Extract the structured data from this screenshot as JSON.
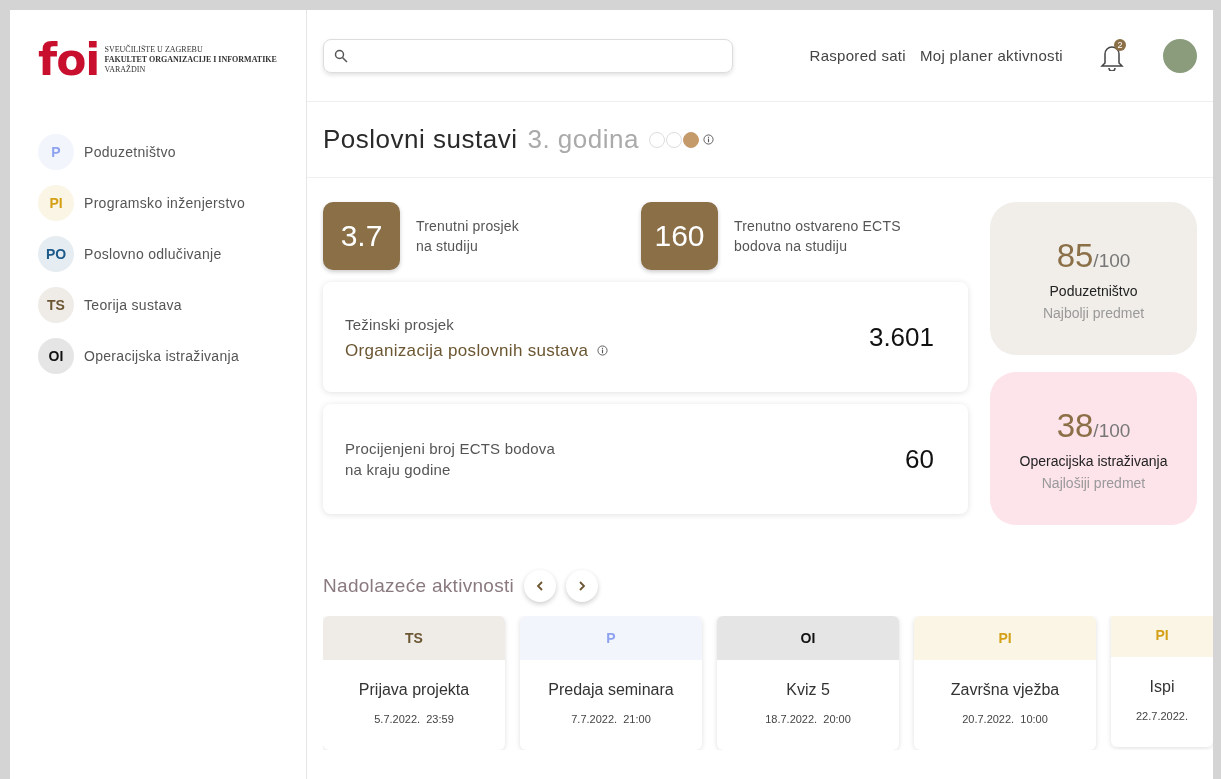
{
  "logo": {
    "mark": "foi",
    "lines": [
      "SVEUČILIŠTE U ZAGREBU",
      "FAKULTET ORGANIZACIJE I INFORMATIKE",
      "VARAŽDIN"
    ]
  },
  "sidebar": {
    "items": [
      {
        "abbr": "P",
        "label": "Poduzetništvo",
        "color": "#8ea2f0"
      },
      {
        "abbr": "PI",
        "label": "Programsko inženjerstvo",
        "color": "#d4a017"
      },
      {
        "abbr": "PO",
        "label": "Poslovno odlučivanje",
        "color": "#1d5a8a"
      },
      {
        "abbr": "TS",
        "label": "Teorija sustava",
        "color": "#6b5632"
      },
      {
        "abbr": "OI",
        "label": "Operacijska istraživanja",
        "color": "#111111"
      }
    ]
  },
  "nav_links": [
    "Raspored sati",
    "Moj planer aktivnosti"
  ],
  "notifications": {
    "count": "2"
  },
  "heading": {
    "title": "Poslovni sustavi",
    "year": "3. godina",
    "year_dots": [
      {
        "filled": false
      },
      {
        "filled": false
      },
      {
        "filled": true
      }
    ]
  },
  "stats": [
    {
      "value": "3.7",
      "label": "Trenutni prosjek\nna studiju"
    },
    {
      "value": "160",
      "label": "Trenutno ostvareno ECTS\nbodova na studiju"
    }
  ],
  "cards": [
    {
      "kind": "weighted",
      "label": "Težinski prosjek",
      "subtitle": "Organizacija poslovnih sustava",
      "value": "3.601"
    },
    {
      "kind": "plain",
      "label": "Procijenjeni broj ECTS bodova\nna kraju godine",
      "value": "60"
    }
  ],
  "subject_scores": [
    {
      "kind": "best",
      "score": "85",
      "max": "/100",
      "subject": "Poduzetništvo",
      "caption": "Najbolji predmet"
    },
    {
      "kind": "worst",
      "score": "38",
      "max": "/100",
      "subject": "Operacijska istraživanja",
      "caption": "Najlošiji predmet"
    }
  ],
  "activities": {
    "title": "Nadolazeće aktivnosti",
    "items": [
      {
        "abbr": "TS",
        "color": "#6b5632",
        "name": "Prijava projekta",
        "date": "5.7.2022.",
        "time": "23:59"
      },
      {
        "abbr": "P",
        "color": "#8ea2f0",
        "name": "Predaja seminara",
        "date": "7.7.2022.",
        "time": "21:00"
      },
      {
        "abbr": "OI",
        "color": "#111111",
        "name": "Kviz 5",
        "date": "18.7.2022.",
        "time": "20:00"
      },
      {
        "abbr": "PI",
        "color": "#d4a017",
        "name": "Završna vježba",
        "date": "20.7.2022.",
        "time": "10:00"
      },
      {
        "abbr": "PI",
        "color": "#d4a017",
        "name": "Ispi",
        "date": "22.7.2022."
      }
    ]
  }
}
